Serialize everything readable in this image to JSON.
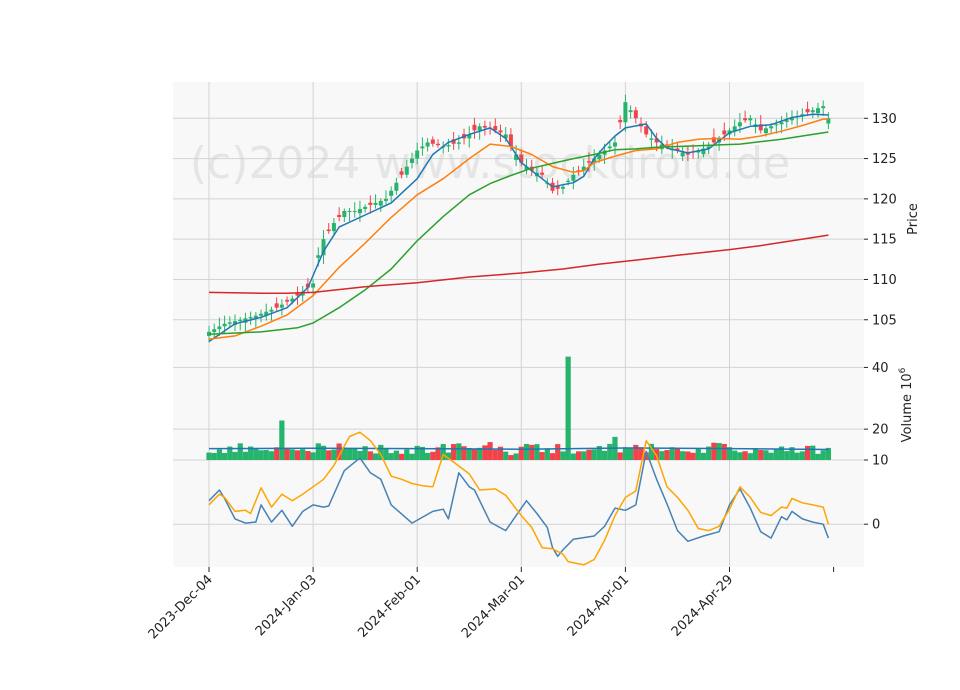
{
  "watermark": "(c)2024 www.stockdroid.de",
  "colors": {
    "panel_bg": "#f8f8f8",
    "grid": "#d3d3d3",
    "up": "#26b36b",
    "down": "#f2434b",
    "ma_fast": "#1f77b4",
    "ma_mid": "#ff7f0e",
    "ma_slow": "#2ca02c",
    "ma_long": "#d62728",
    "vol_avg": "#1f77b4",
    "macd": "#4682b4",
    "signal": "#ffa500"
  },
  "chart_data": {
    "type": "candlestick",
    "x_tick_labels": [
      "2023-Dec-04",
      "2024-Jan-03",
      "2024-Feb-01",
      "2024-Mar-01",
      "2024-Apr-01",
      "2024-Apr-29"
    ],
    "price_panel": {
      "ylabel": "Price",
      "yticks": [
        105,
        110,
        115,
        120,
        125,
        130
      ],
      "ylim": [
        101,
        134.5
      ],
      "close_path": [
        [
          0,
          103.5
        ],
        [
          3,
          104.5
        ],
        [
          6,
          105
        ],
        [
          9,
          105.5
        ],
        [
          13,
          106.5
        ],
        [
          17,
          108
        ],
        [
          20,
          109.5
        ],
        [
          21,
          113
        ],
        [
          22,
          115
        ],
        [
          24,
          117
        ],
        [
          26,
          118.5
        ],
        [
          28,
          118.5
        ],
        [
          30,
          119
        ],
        [
          32,
          119.5
        ],
        [
          34,
          120
        ],
        [
          36,
          122
        ],
        [
          38,
          124
        ],
        [
          40,
          126
        ],
        [
          42,
          127
        ],
        [
          45,
          126.5
        ],
        [
          48,
          127
        ],
        [
          50,
          128
        ],
        [
          52,
          129
        ],
        [
          55,
          128.5
        ],
        [
          57,
          128
        ],
        [
          58,
          126.5
        ],
        [
          60,
          124.5
        ],
        [
          62,
          123.5
        ],
        [
          64,
          123
        ],
        [
          66,
          121
        ],
        [
          68,
          121.5
        ],
        [
          70,
          123
        ],
        [
          72,
          124
        ],
        [
          74,
          125
        ],
        [
          76,
          126
        ],
        [
          78,
          127
        ],
        [
          80,
          132
        ],
        [
          82,
          130
        ],
        [
          84,
          128
        ],
        [
          86,
          127
        ],
        [
          88,
          126.5
        ],
        [
          90,
          126
        ],
        [
          92,
          125.5
        ],
        [
          94,
          126
        ],
        [
          96,
          126.5
        ],
        [
          98,
          127.5
        ],
        [
          100,
          128.5
        ],
        [
          102,
          129.5
        ],
        [
          104,
          130
        ],
        [
          106,
          128.5
        ],
        [
          108,
          129
        ],
        [
          110,
          129.5
        ],
        [
          112,
          130
        ],
        [
          114,
          130.5
        ],
        [
          116,
          131
        ],
        [
          118,
          131.5
        ],
        [
          119,
          130
        ]
      ],
      "moving_averages": [
        {
          "id": "ma_fast",
          "points": [
            [
              0,
              102.3
            ],
            [
              5,
              104.5
            ],
            [
              10,
              105.3
            ],
            [
              15,
              106.5
            ],
            [
              19,
              109
            ],
            [
              22,
              113.5
            ],
            [
              25,
              116.5
            ],
            [
              30,
              118
            ],
            [
              35,
              119.5
            ],
            [
              40,
              122.5
            ],
            [
              43,
              125.5
            ],
            [
              46,
              127
            ],
            [
              50,
              128
            ],
            [
              54,
              128.8
            ],
            [
              57,
              127.5
            ],
            [
              60,
              124.5
            ],
            [
              63,
              123
            ],
            [
              66,
              121.5
            ],
            [
              70,
              122
            ],
            [
              72,
              122.8
            ],
            [
              74,
              125
            ],
            [
              76,
              126.5
            ],
            [
              78,
              127.8
            ],
            [
              80,
              128.8
            ],
            [
              84,
              129.3
            ],
            [
              86,
              127.5
            ],
            [
              88,
              126.3
            ],
            [
              92,
              125.7
            ],
            [
              96,
              126.2
            ],
            [
              100,
              128.2
            ],
            [
              104,
              129
            ],
            [
              108,
              129.2
            ],
            [
              112,
              130.1
            ],
            [
              116,
              130.5
            ],
            [
              119,
              130.4
            ]
          ]
        },
        {
          "id": "ma_mid",
          "points": [
            [
              0,
              102.6
            ],
            [
              5,
              103
            ],
            [
              10,
              104.2
            ],
            [
              15,
              105.6
            ],
            [
              20,
              108
            ],
            [
              25,
              111.5
            ],
            [
              30,
              114.5
            ],
            [
              35,
              117.7
            ],
            [
              40,
              120.5
            ],
            [
              45,
              122.5
            ],
            [
              50,
              125
            ],
            [
              54,
              126.8
            ],
            [
              58,
              126.5
            ],
            [
              62,
              125.5
            ],
            [
              66,
              124
            ],
            [
              70,
              123.3
            ],
            [
              72,
              123.5
            ],
            [
              74,
              124.5
            ],
            [
              78,
              125.3
            ],
            [
              82,
              126
            ],
            [
              86,
              126.2
            ],
            [
              90,
              127
            ],
            [
              94,
              127.4
            ],
            [
              98,
              127.5
            ],
            [
              102,
              127.4
            ],
            [
              106,
              127.8
            ],
            [
              110,
              128.4
            ],
            [
              114,
              129.1
            ],
            [
              118,
              129.9
            ],
            [
              119,
              129.9
            ]
          ]
        },
        {
          "id": "ma_slow",
          "points": [
            [
              0,
              103.2
            ],
            [
              10,
              103.5
            ],
            [
              17,
              104
            ],
            [
              20,
              104.6
            ],
            [
              25,
              106.5
            ],
            [
              30,
              108.7
            ],
            [
              35,
              111.3
            ],
            [
              40,
              114.8
            ],
            [
              45,
              117.8
            ],
            [
              50,
              120.5
            ],
            [
              54,
              121.9
            ],
            [
              58,
              122.9
            ],
            [
              62,
              123.8
            ],
            [
              66,
              124.4
            ],
            [
              70,
              125
            ],
            [
              74,
              125.5
            ],
            [
              78,
              126.1
            ],
            [
              82,
              126.2
            ],
            [
              86,
              126.4
            ],
            [
              90,
              126.5
            ],
            [
              94,
              126.6
            ],
            [
              98,
              126.7
            ],
            [
              102,
              126.8
            ],
            [
              106,
              127.1
            ],
            [
              110,
              127.4
            ],
            [
              114,
              127.8
            ],
            [
              119,
              128.3
            ]
          ]
        },
        {
          "id": "ma_long",
          "points": [
            [
              0,
              108.4
            ],
            [
              10,
              108.3
            ],
            [
              15,
              108.3
            ],
            [
              20,
              108.4
            ],
            [
              30,
              109.1
            ],
            [
              40,
              109.6
            ],
            [
              50,
              110.3
            ],
            [
              60,
              110.8
            ],
            [
              68,
              111.3
            ],
            [
              75,
              111.9
            ],
            [
              82,
              112.4
            ],
            [
              90,
              113
            ],
            [
              100,
              113.7
            ],
            [
              106,
              114.2
            ],
            [
              110,
              114.6
            ],
            [
              115,
              115.1
            ],
            [
              119,
              115.5
            ]
          ]
        }
      ]
    },
    "volume_panel": {
      "ylabel": "Volume 10^6",
      "yticks": [
        10,
        20,
        40
      ],
      "ylim": [
        10,
        45
      ],
      "spikes": [
        [
          14,
          22.8
        ],
        [
          54,
          15.8
        ],
        [
          58,
          11.6
        ],
        [
          69,
          43.5
        ],
        [
          78,
          17.5
        ],
        [
          97,
          15.6
        ]
      ],
      "average_path": [
        [
          0,
          13.7
        ],
        [
          20,
          13.8
        ],
        [
          40,
          13.7
        ],
        [
          60,
          13.5
        ],
        [
          80,
          13.9
        ],
        [
          100,
          13.7
        ],
        [
          119,
          13.4
        ]
      ]
    },
    "macd_panel": {
      "yticks": [
        0
      ],
      "ylim": [
        -4,
        6
      ],
      "macd": [
        [
          0,
          2.2
        ],
        [
          2,
          3.2
        ],
        [
          3,
          2.4
        ],
        [
          5,
          0.5
        ],
        [
          7,
          0.1
        ],
        [
          9,
          0.2
        ],
        [
          10,
          1.8
        ],
        [
          12,
          0.2
        ],
        [
          14,
          1.3
        ],
        [
          16,
          -0.2
        ],
        [
          18,
          1.2
        ],
        [
          20,
          1.8
        ],
        [
          22,
          1.6
        ],
        [
          23,
          1.7
        ],
        [
          26,
          5
        ],
        [
          29,
          6.2
        ],
        [
          31,
          4.8
        ],
        [
          33,
          4.2
        ],
        [
          35,
          1.8
        ],
        [
          39,
          0.1
        ],
        [
          43,
          1.2
        ],
        [
          45,
          1.4
        ],
        [
          46,
          0.5
        ],
        [
          48,
          4.8
        ],
        [
          50,
          3.5
        ],
        [
          51,
          3.2
        ],
        [
          54,
          0.2
        ],
        [
          57,
          -0.6
        ],
        [
          59,
          0.8
        ],
        [
          61,
          2.2
        ],
        [
          63,
          1
        ],
        [
          65,
          -0.3
        ],
        [
          66,
          -2.2
        ],
        [
          67,
          -3
        ],
        [
          68,
          -2.4
        ],
        [
          70,
          -1.4
        ],
        [
          74,
          -1.1
        ],
        [
          76,
          -0.2
        ],
        [
          78,
          1.5
        ],
        [
          80,
          1.3
        ],
        [
          82,
          1.8
        ],
        [
          84,
          6.8
        ],
        [
          86,
          4.2
        ],
        [
          88,
          1.9
        ],
        [
          90,
          -0.6
        ],
        [
          92,
          -1.6
        ],
        [
          95,
          -1.1
        ],
        [
          98,
          -0.7
        ],
        [
          100,
          1.8
        ],
        [
          102,
          3.3
        ],
        [
          104,
          1.5
        ],
        [
          106,
          -0.7
        ],
        [
          108,
          -1.3
        ],
        [
          110,
          0.7
        ],
        [
          111,
          0.4
        ],
        [
          112,
          1.2
        ],
        [
          114,
          0.5
        ],
        [
          116,
          0.2
        ],
        [
          118,
          0
        ],
        [
          119,
          -1.3
        ]
      ],
      "signal": [
        [
          0,
          1.8
        ],
        [
          2,
          2.8
        ],
        [
          3,
          2.5
        ],
        [
          5,
          1.2
        ],
        [
          7,
          1.3
        ],
        [
          8,
          1
        ],
        [
          10,
          3.4
        ],
        [
          12,
          1.6
        ],
        [
          14,
          2.8
        ],
        [
          16,
          2.2
        ],
        [
          18,
          2.8
        ],
        [
          20,
          3.5
        ],
        [
          22,
          4.2
        ],
        [
          24,
          5.5
        ],
        [
          27,
          8.2
        ],
        [
          29,
          8.6
        ],
        [
          31,
          7.8
        ],
        [
          33,
          6.5
        ],
        [
          35,
          4.5
        ],
        [
          37,
          4.2
        ],
        [
          39,
          3.8
        ],
        [
          41,
          3.6
        ],
        [
          43,
          3.5
        ],
        [
          45,
          6.5
        ],
        [
          47,
          5.8
        ],
        [
          50,
          4.7
        ],
        [
          52,
          3.2
        ],
        [
          55,
          3.3
        ],
        [
          57,
          2.7
        ],
        [
          60,
          0.8
        ],
        [
          62,
          -0.3
        ],
        [
          64,
          -2.2
        ],
        [
          66,
          -2.3
        ],
        [
          68,
          -2.8
        ],
        [
          69,
          -3.5
        ],
        [
          72,
          -3.8
        ],
        [
          74,
          -3.3
        ],
        [
          76,
          -1.5
        ],
        [
          78,
          0.8
        ],
        [
          80,
          2.5
        ],
        [
          82,
          3.1
        ],
        [
          84,
          7.8
        ],
        [
          86,
          6.4
        ],
        [
          88,
          3.5
        ],
        [
          90,
          2.5
        ],
        [
          92,
          1.3
        ],
        [
          94,
          -0.4
        ],
        [
          96,
          -0.6
        ],
        [
          98,
          -0.2
        ],
        [
          100,
          1.4
        ],
        [
          102,
          3.5
        ],
        [
          104,
          2.5
        ],
        [
          106,
          1.1
        ],
        [
          108,
          0.8
        ],
        [
          110,
          1.6
        ],
        [
          111,
          1.5
        ],
        [
          112,
          2.4
        ],
        [
          114,
          2
        ],
        [
          116,
          1.8
        ],
        [
          118,
          1.6
        ],
        [
          119,
          0
        ]
      ]
    }
  }
}
